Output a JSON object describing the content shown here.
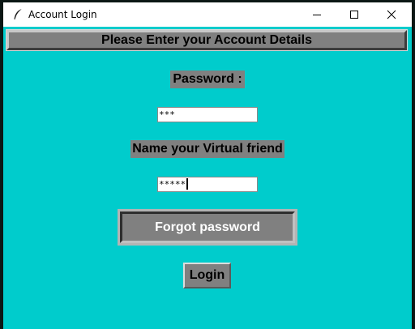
{
  "window": {
    "title": "Account Login",
    "app_icon": "feather-icon",
    "controls": {
      "minimize": "minimize-icon",
      "maximize": "maximize-icon",
      "close": "close-icon"
    }
  },
  "header": {
    "text": "Please Enter your Account Details"
  },
  "form": {
    "password_label": "Password :",
    "password_value": "***",
    "friend_label": "Name your Virtual friend",
    "friend_value": "*****",
    "forgot_label": "Forgot password",
    "login_label": "Login"
  },
  "colors": {
    "background": "#00cccc",
    "widget": "#808080"
  }
}
